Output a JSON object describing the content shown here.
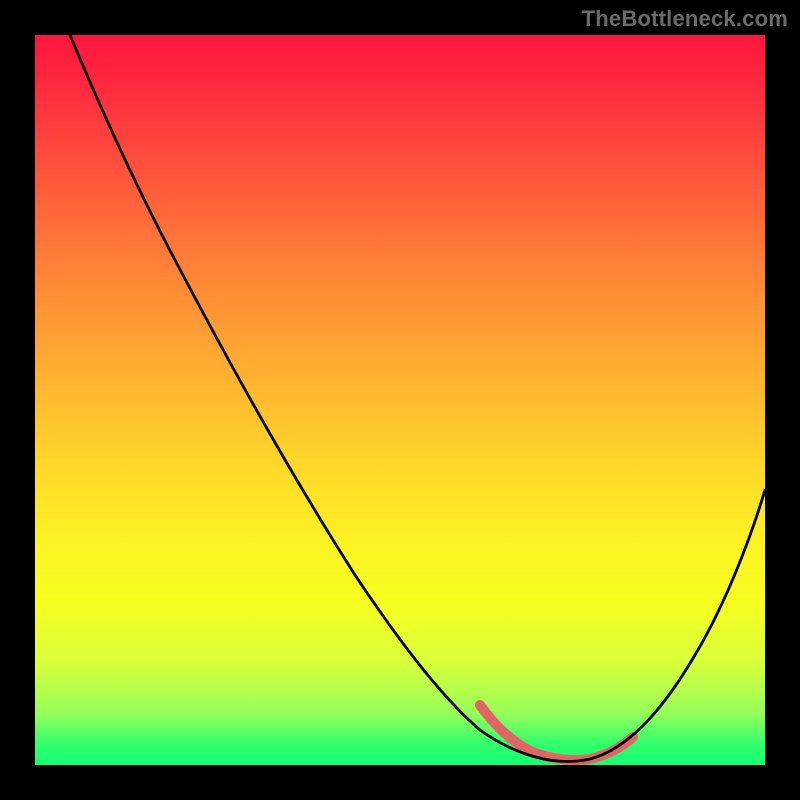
{
  "watermark": "TheBottleneck.com",
  "colors": {
    "background": "#000000",
    "gradient_top": "#ff163e",
    "gradient_bottom": "#14ff74",
    "curve": "#000000",
    "highlight_segment": "#e06666"
  },
  "chart_data": {
    "type": "line",
    "title": "",
    "xlabel": "",
    "ylabel": "",
    "xlim": [
      0,
      100
    ],
    "ylim": [
      0,
      100
    ],
    "x": [
      0,
      5,
      10,
      15,
      20,
      25,
      30,
      35,
      40,
      45,
      50,
      55,
      57,
      60,
      63,
      67,
      70,
      73,
      77,
      80,
      83,
      86,
      90,
      93,
      96,
      100
    ],
    "values": [
      100,
      97,
      93,
      87,
      80,
      73,
      65,
      57,
      49,
      40,
      31,
      21,
      16,
      9,
      5,
      2,
      1,
      0,
      0,
      1,
      4,
      9,
      16,
      24,
      33,
      44
    ],
    "highlight_range_x": [
      60,
      82
    ],
    "note": "Values estimated from pixel positions; y=0 at bottom (green), y=100 at top (red). The curve descends from top-left, reaches a minimum around x≈73–77, then rises toward the right. A pink/red thick segment marks the region near the minimum from roughly x=60 to x=82."
  }
}
